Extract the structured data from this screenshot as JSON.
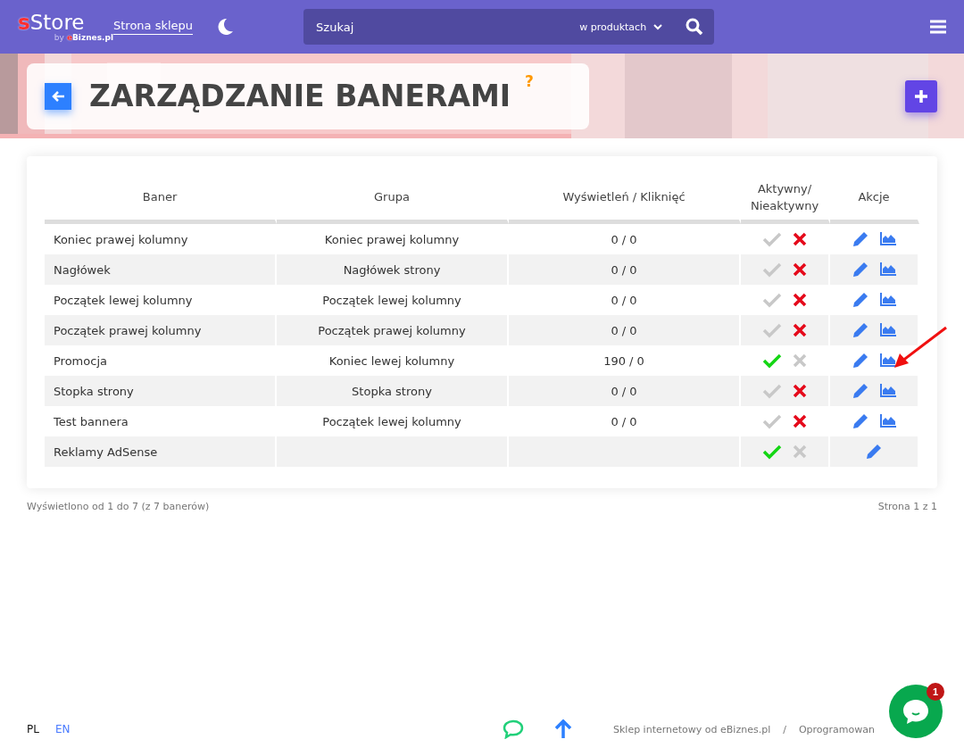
{
  "header": {
    "logo_letter": "s",
    "logo_name": "Store",
    "logo_by": "by",
    "logo_brand_letter": "e",
    "logo_brand": "Biznes.pl",
    "shop_link": "Strona sklepu",
    "search": {
      "placeholder": "Szukaj",
      "scope": "w produktach"
    }
  },
  "page": {
    "title": "ZARZĄDZANIE BANERAMI",
    "help": "?"
  },
  "table": {
    "columns": [
      "Baner",
      "Grupa",
      "Wyświetleń / Kliknięć",
      "Aktywny/ Nieaktywny",
      "Akcje"
    ],
    "rows": [
      {
        "name": "Koniec prawej kolumny",
        "group": "Koniec prawej kolumny",
        "stats": "0 / 0",
        "active": false,
        "has_stats": true
      },
      {
        "name": "Nagłówek",
        "group": "Nagłówek strony",
        "stats": "0 / 0",
        "active": false,
        "has_stats": true
      },
      {
        "name": "Początek lewej kolumny",
        "group": "Początek lewej kolumny",
        "stats": "0 / 0",
        "active": false,
        "has_stats": true
      },
      {
        "name": "Początek prawej kolumny",
        "group": "Początek prawej kolumny",
        "stats": "0 / 0",
        "active": false,
        "has_stats": true
      },
      {
        "name": "Promocja",
        "group": "Koniec lewej kolumny",
        "stats": "190 / 0",
        "active": true,
        "has_stats": true
      },
      {
        "name": "Stopka strony",
        "group": "Stopka strony",
        "stats": "0 / 0",
        "active": false,
        "has_stats": true
      },
      {
        "name": "Test bannera",
        "group": "Początek lewej kolumny",
        "stats": "0 / 0",
        "active": false,
        "has_stats": true
      },
      {
        "name": "Reklamy AdSense",
        "active": true,
        "has_stats": false
      }
    ]
  },
  "summary": "Wyświetlono od 1 do 7 (z 7 banerów)",
  "pagination": "Strona 1 z 1",
  "footer": {
    "languages": [
      {
        "label": "PL",
        "selected": true
      },
      {
        "label": "EN",
        "selected": false
      }
    ],
    "links": [
      "Sklep internetowy od eBiznes.pl",
      "/",
      "Oprogramowan"
    ],
    "chat_badge": "1"
  }
}
